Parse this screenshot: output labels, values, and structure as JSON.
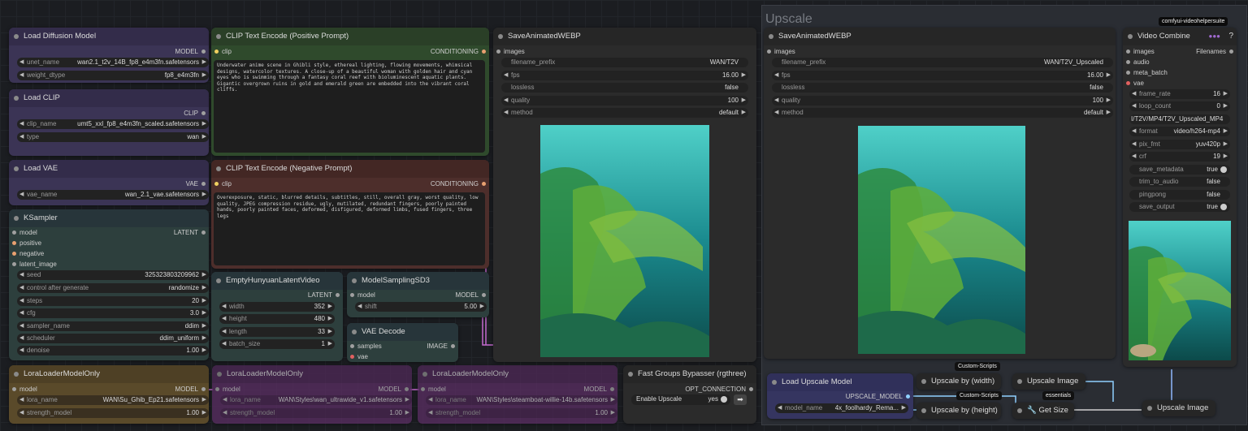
{
  "upscale_group_title": "Upscale",
  "helper_badge": "comfyui-videohelpersuite",
  "load_diffusion": {
    "title": "Load Diffusion Model",
    "out": "MODEL",
    "unet_label": "unet_name",
    "unet_value": "wan2.1_t2v_14B_fp8_e4m3fn.safetensors",
    "dtype_label": "weight_dtype",
    "dtype_value": "fp8_e4m3fn"
  },
  "load_clip": {
    "title": "Load CLIP",
    "out": "CLIP",
    "name_label": "clip_name",
    "name_value": "umt5_xxl_fp8_e4m3fn_scaled.safetensors",
    "type_label": "type",
    "type_value": "wan"
  },
  "load_vae": {
    "title": "Load VAE",
    "out": "VAE",
    "name_label": "vae_name",
    "name_value": "wan_2.1_vae.safetensors"
  },
  "ksampler": {
    "title": "KSampler",
    "out": "LATENT",
    "inputs": [
      "model",
      "positive",
      "negative",
      "latent_image"
    ],
    "widgets": [
      {
        "l": "seed",
        "v": "325323803209962"
      },
      {
        "l": "control after generate",
        "v": "randomize"
      },
      {
        "l": "steps",
        "v": "20"
      },
      {
        "l": "cfg",
        "v": "3.0"
      },
      {
        "l": "sampler_name",
        "v": "ddim"
      },
      {
        "l": "scheduler",
        "v": "ddim_uniform"
      },
      {
        "l": "denoise",
        "v": "1.00"
      }
    ]
  },
  "lora1": {
    "title": "LoraLoaderModelOnly",
    "in": "model",
    "out": "MODEL",
    "name_label": "lora_name",
    "name_value": "WAN\\Su_Ghib_Ep21.safetensors",
    "strength_label": "strength_model",
    "strength_value": "1.00"
  },
  "lora2": {
    "title": "LoraLoaderModelOnly",
    "in": "model",
    "out": "MODEL",
    "name_label": "lora_name",
    "name_value": "WAN\\Styles\\wan_ultrawide_v1.safetensors",
    "strength_label": "strength_model",
    "strength_value": "1.00"
  },
  "lora3": {
    "title": "LoraLoaderModelOnly",
    "in": "model",
    "out": "MODEL",
    "name_label": "lora_name",
    "name_value": "WAN\\Styles\\steamboat-willie-14b.safetensors",
    "strength_label": "strength_model",
    "strength_value": "1.00"
  },
  "clip_pos": {
    "title": "CLIP Text Encode (Positive Prompt)",
    "in": "clip",
    "out": "CONDITIONING",
    "text": "Underwater anime scene in Ghibli style, ethereal lighting, flowing movements, whimsical designs, watercolor textures. A close-up of a beautiful woman with golden hair and cyan eyes who is swimming through a fantasy coral reef with bioluminescent aquatic plants. Gigantic overgrown ruins in gold and emerald green are embedded into the vibrant coral cliffs."
  },
  "clip_neg": {
    "title": "CLIP Text Encode (Negative Prompt)",
    "in": "clip",
    "out": "CONDITIONING",
    "text": "Overexposure, static, blurred details, subtitles, still, overall gray, worst quality, low quality, JPEG compression residue, ugly, mutilated, redundant fingers, poorly painted hands, poorly painted faces, deformed, disfigured, deformed limbs, fused fingers, three legs"
  },
  "empty_latent": {
    "title": "EmptyHunyuanLatentVideo",
    "out": "LATENT",
    "widgets": [
      {
        "l": "width",
        "v": "352"
      },
      {
        "l": "height",
        "v": "480"
      },
      {
        "l": "length",
        "v": "33"
      },
      {
        "l": "batch_size",
        "v": "1"
      }
    ]
  },
  "model_sampling": {
    "title": "ModelSamplingSD3",
    "in": "model",
    "out": "MODEL",
    "shift_label": "shift",
    "shift_value": "5.00"
  },
  "vae_decode": {
    "title": "VAE Decode",
    "in1": "samples",
    "in2": "vae",
    "out": "IMAGE"
  },
  "save1": {
    "title": "SaveAnimatedWEBP",
    "in": "images",
    "widgets": [
      {
        "l": "filename_prefix",
        "v": "WAN/T2V"
      },
      {
        "l": "fps",
        "v": "16.00"
      },
      {
        "l": "lossless",
        "v": "false"
      },
      {
        "l": "quality",
        "v": "100"
      },
      {
        "l": "method",
        "v": "default"
      }
    ]
  },
  "save2": {
    "title": "SaveAnimatedWEBP",
    "in": "images",
    "widgets": [
      {
        "l": "filename_prefix",
        "v": "WAN/T2V_Upscaled"
      },
      {
        "l": "fps",
        "v": "16.00"
      },
      {
        "l": "lossless",
        "v": "false"
      },
      {
        "l": "quality",
        "v": "100"
      },
      {
        "l": "method",
        "v": "default"
      }
    ]
  },
  "video_combine": {
    "title": "Video Combine",
    "help": "?",
    "inputs": [
      "images",
      "audio",
      "meta_batch",
      "vae"
    ],
    "out": "Filenames",
    "prefix_overlay": "I/T2V/MP4/T2V_Upscaled_MP4",
    "widgets": [
      {
        "l": "frame_rate",
        "v": "16"
      },
      {
        "l": "loop_count",
        "v": "0"
      },
      {
        "l": "format",
        "v": "video/h264-mp4"
      },
      {
        "l": "pix_fmt",
        "v": "yuv420p"
      },
      {
        "l": "crf",
        "v": "19"
      },
      {
        "l": "save_metadata",
        "v": "true"
      },
      {
        "l": "trim_to_audio",
        "v": "false"
      },
      {
        "l": "pingpong",
        "v": "false"
      },
      {
        "l": "save_output",
        "v": "true"
      }
    ]
  },
  "fast_groups": {
    "title": "Fast Groups Bypasser (rgthree)",
    "out": "OPT_CONNECTION",
    "toggle_label": "Enable Upscale",
    "toggle_value": "yes"
  },
  "load_upscale": {
    "title": "Load Upscale Model",
    "out": "UPSCALE_MODEL",
    "name_label": "model_name",
    "name_value": "4x_foolhardy_Rema..."
  },
  "upscale_width": {
    "title": "Upscale by (width)",
    "badge": "Custom-Scripts"
  },
  "upscale_height": {
    "title": "Upscale by (height)",
    "badge": "Custom-Scripts"
  },
  "upscale_image_1": {
    "title": "Upscale Image"
  },
  "upscale_image_2": {
    "title": "Upscale Image"
  },
  "get_size": {
    "title": "Get Size",
    "badge": "essentials"
  }
}
